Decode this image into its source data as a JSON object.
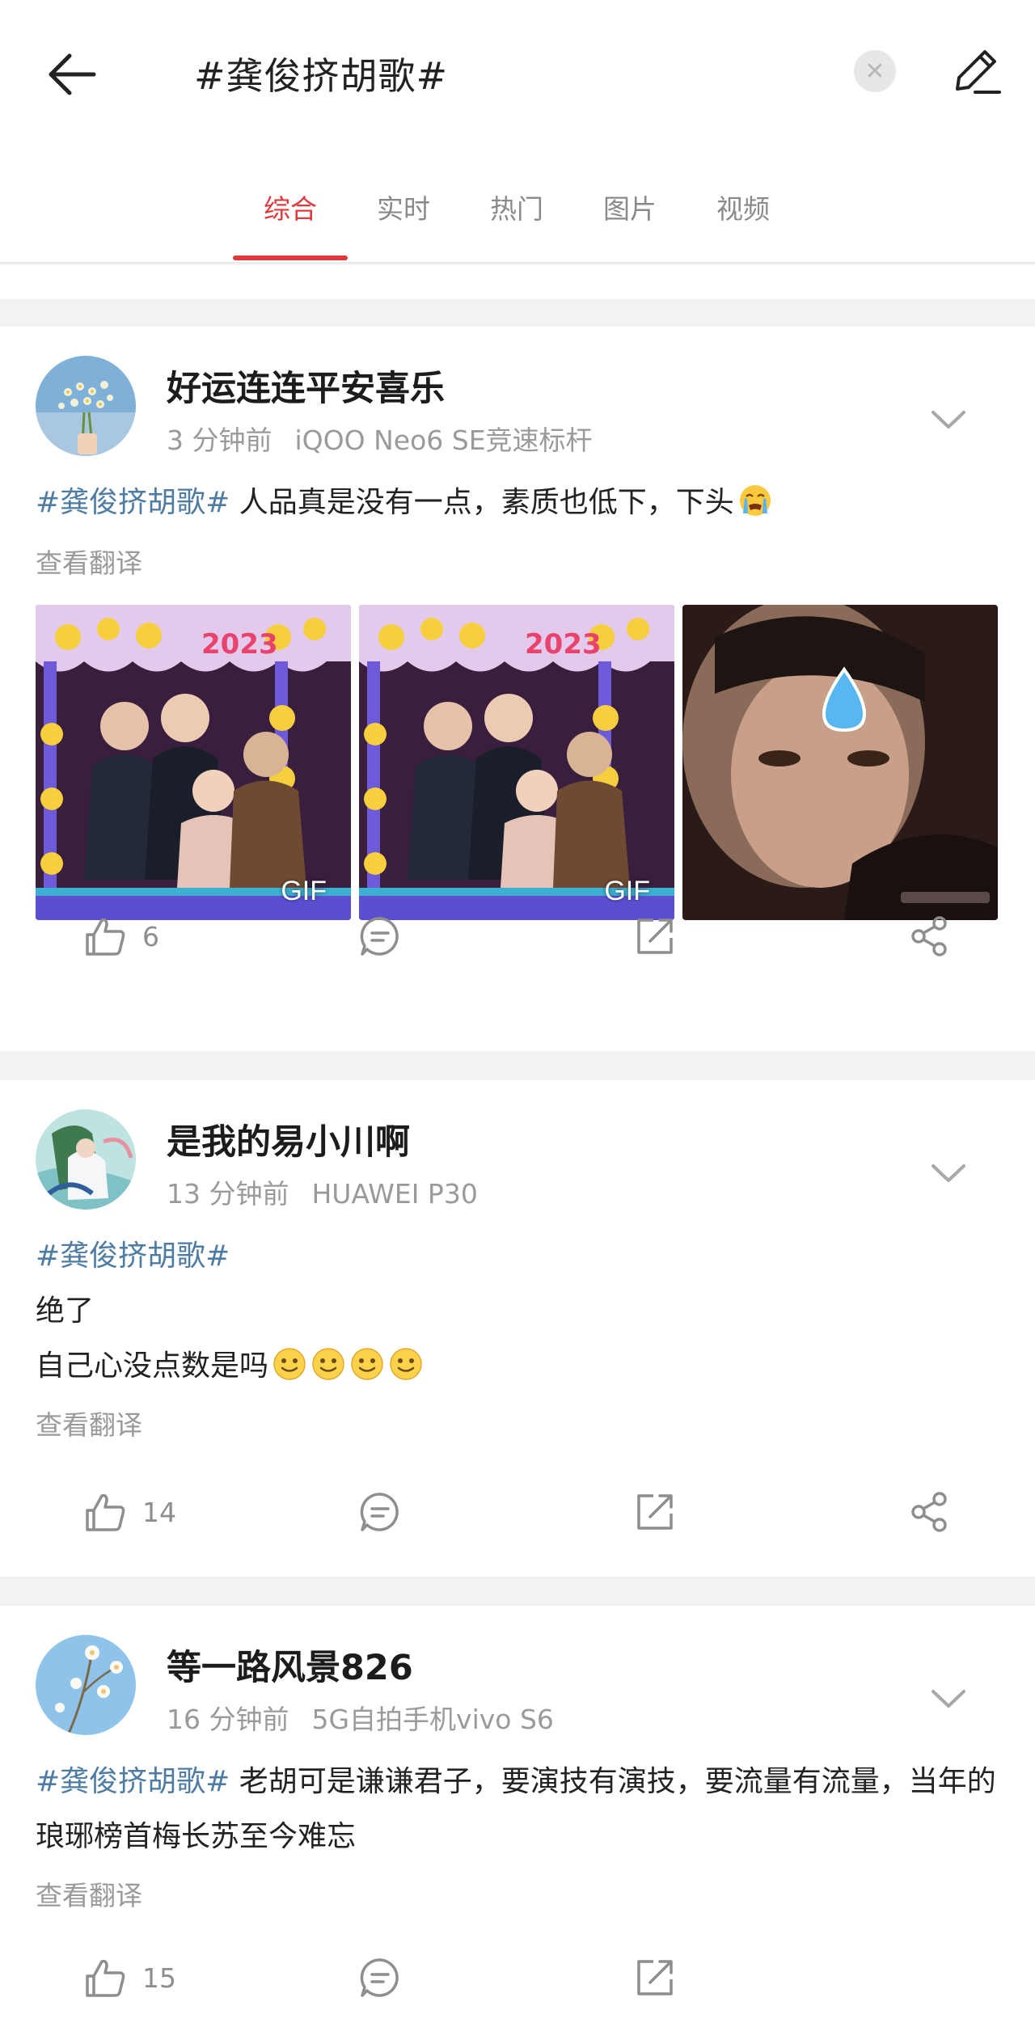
{
  "header": {
    "query": "#龚俊挤胡歌#",
    "tabs": [
      {
        "label": "综合",
        "active": true
      },
      {
        "label": "实时"
      },
      {
        "label": "热门"
      },
      {
        "label": "图片"
      },
      {
        "label": "视频"
      }
    ]
  },
  "colors": {
    "accent": "#e0393b",
    "hashtag": "#4f7ca3",
    "muted": "#9a9a9a"
  },
  "posts": [
    {
      "username": "好运连连平安喜乐",
      "time": "3 分钟前",
      "device": "iQOO Neo6 SE竞速标杆",
      "hashtag": "#龚俊挤胡歌#",
      "text": " 人品真是没有一点，素质也低下，下头",
      "emoji": "tears-emoji",
      "translate": "查看翻译",
      "images": [
        {
          "badge": "GIF",
          "year": "2023"
        },
        {
          "badge": "GIF",
          "year": "2023"
        },
        {
          "badge": ""
        }
      ],
      "likes": "6"
    },
    {
      "username": "是我的易小川啊",
      "time": "13 分钟前",
      "device": "HUAWEI P30",
      "hashtag": "#龚俊挤胡歌#",
      "line1": "绝了",
      "line2": "自己心没点数是吗",
      "emoji": "smile-emoji",
      "translate": "查看翻译",
      "likes": "14"
    },
    {
      "username": "等一路风景826",
      "time": "16 分钟前",
      "device": "5G自拍手机vivo S6",
      "hashtag": "#龚俊挤胡歌#",
      "text": " 老胡可是谦谦君子，要演技有演技，要流量有流量，当年的琅琊榜首梅长苏至今难忘",
      "translate": "查看翻译",
      "likes": "15"
    }
  ]
}
